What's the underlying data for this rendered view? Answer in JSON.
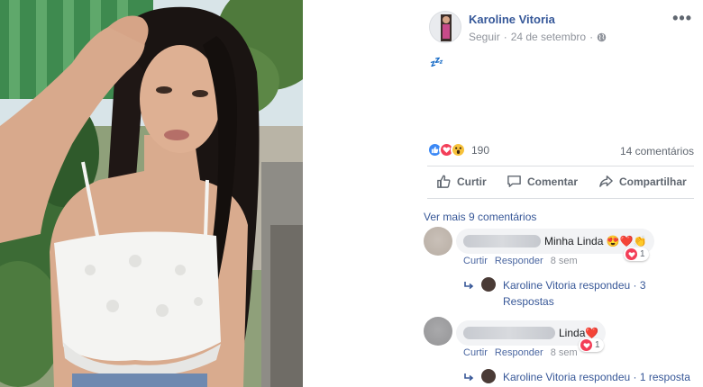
{
  "post": {
    "author": "Karoline Vitoria",
    "follow_label": "Seguir",
    "separator": "·",
    "date": "24 de setembro",
    "more_label": "•••",
    "text": "💤",
    "reactions_count": "190",
    "comments_count": "14 comentários"
  },
  "actions": {
    "like": "Curtir",
    "comment": "Comentar",
    "share": "Compartilhar"
  },
  "comments_section": {
    "see_more": "Ver mais 9 comentários",
    "comments": [
      {
        "text": "Minha Linda 😍❤️👏",
        "reaction_count": "1",
        "like_label": "Curtir",
        "reply_label": "Responder",
        "time": "8 sem",
        "reply_summary": "Karoline Vitoria respondeu · 3 Respostas"
      },
      {
        "text": "Linda❤️",
        "reaction_count": "1",
        "like_label": "Curtir",
        "reply_label": "Responder",
        "time": "8 sem",
        "reply_summary": "Karoline Vitoria respondeu · 1 resposta"
      }
    ]
  },
  "colors": {
    "link_blue": "#365899",
    "like_blue": "#3b88f5",
    "love_red": "#f33e58",
    "wow_yellow": "#f7c23b",
    "meta_gray": "#90949c"
  }
}
